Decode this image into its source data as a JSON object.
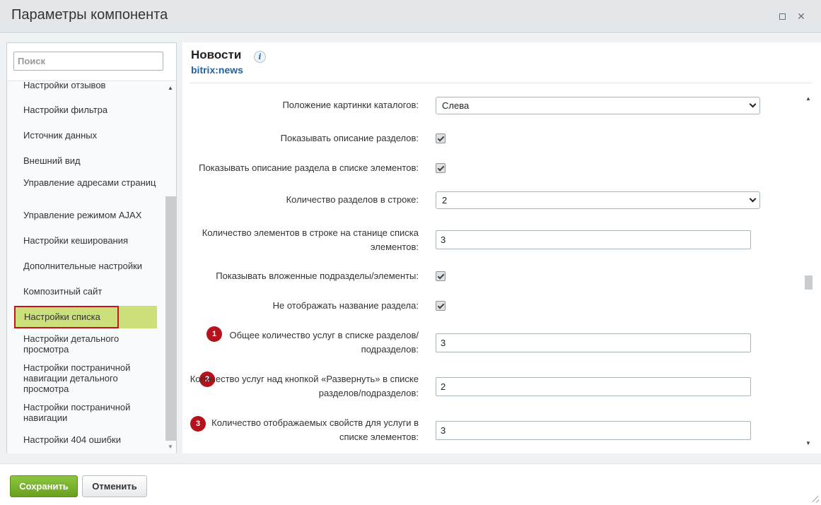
{
  "window": {
    "title": "Параметры компонента"
  },
  "sidebar": {
    "search_placeholder": "Поиск",
    "items": [
      {
        "label": "Настройки отзывов"
      },
      {
        "label": "Настройки фильтра"
      },
      {
        "label": "Источник данных"
      },
      {
        "label": "Внешний вид"
      },
      {
        "label": "Управление адресами страниц"
      },
      {
        "label": "Управление режимом AJAX"
      },
      {
        "label": "Настройки кеширования"
      },
      {
        "label": "Дополнительные настройки"
      },
      {
        "label": "Композитный сайт"
      },
      {
        "label": "Настройки списка"
      },
      {
        "label": "Настройки детального просмотра"
      },
      {
        "label": "Настройки постраничной навигации детального просмотра"
      },
      {
        "label": "Настройки постраничной навигации"
      },
      {
        "label": "Настройки 404 ошибки"
      }
    ],
    "active_item": "Настройки списка"
  },
  "component": {
    "title": "Новости",
    "code": "bitrix:news",
    "info_icon": "i"
  },
  "fields": [
    {
      "label": "Положение картинки каталогов:",
      "type": "select",
      "value": "Слева"
    },
    {
      "label": "Показывать описание разделов:",
      "type": "checkbox",
      "checked": true
    },
    {
      "label": "Показывать описание раздела в списке элементов:",
      "type": "checkbox",
      "checked": true
    },
    {
      "label": "Количество разделов в строке:",
      "type": "select",
      "value": "2"
    },
    {
      "label": "Количество элементов в строке на станице списка элементов:",
      "type": "text",
      "value": "3"
    },
    {
      "label": "Показывать вложенные подразделы/элементы:",
      "type": "checkbox",
      "checked": true
    },
    {
      "label": "Не отображать название раздела:",
      "type": "checkbox",
      "checked": true
    },
    {
      "label": "Общее количество услуг в списке разделов/подразделов:",
      "type": "text",
      "value": "3",
      "badge": "1"
    },
    {
      "label": "Количество услуг над кнопкой «Развернуть» в списке разделов/подразделов:",
      "type": "text",
      "value": "2",
      "badge": "2"
    },
    {
      "label": "Количество отображаемых свойств для услуги в списке элементов:",
      "type": "text",
      "value": "3",
      "badge": "3"
    }
  ],
  "footer": {
    "save_label": "Сохранить",
    "cancel_label": "Отменить"
  },
  "colors": {
    "accent_green": "#6aa01e",
    "active_item_bg": "#cbe07a",
    "active_item_border": "#c8121c",
    "badge_red": "#b5121b",
    "link_blue": "#2162a0"
  }
}
